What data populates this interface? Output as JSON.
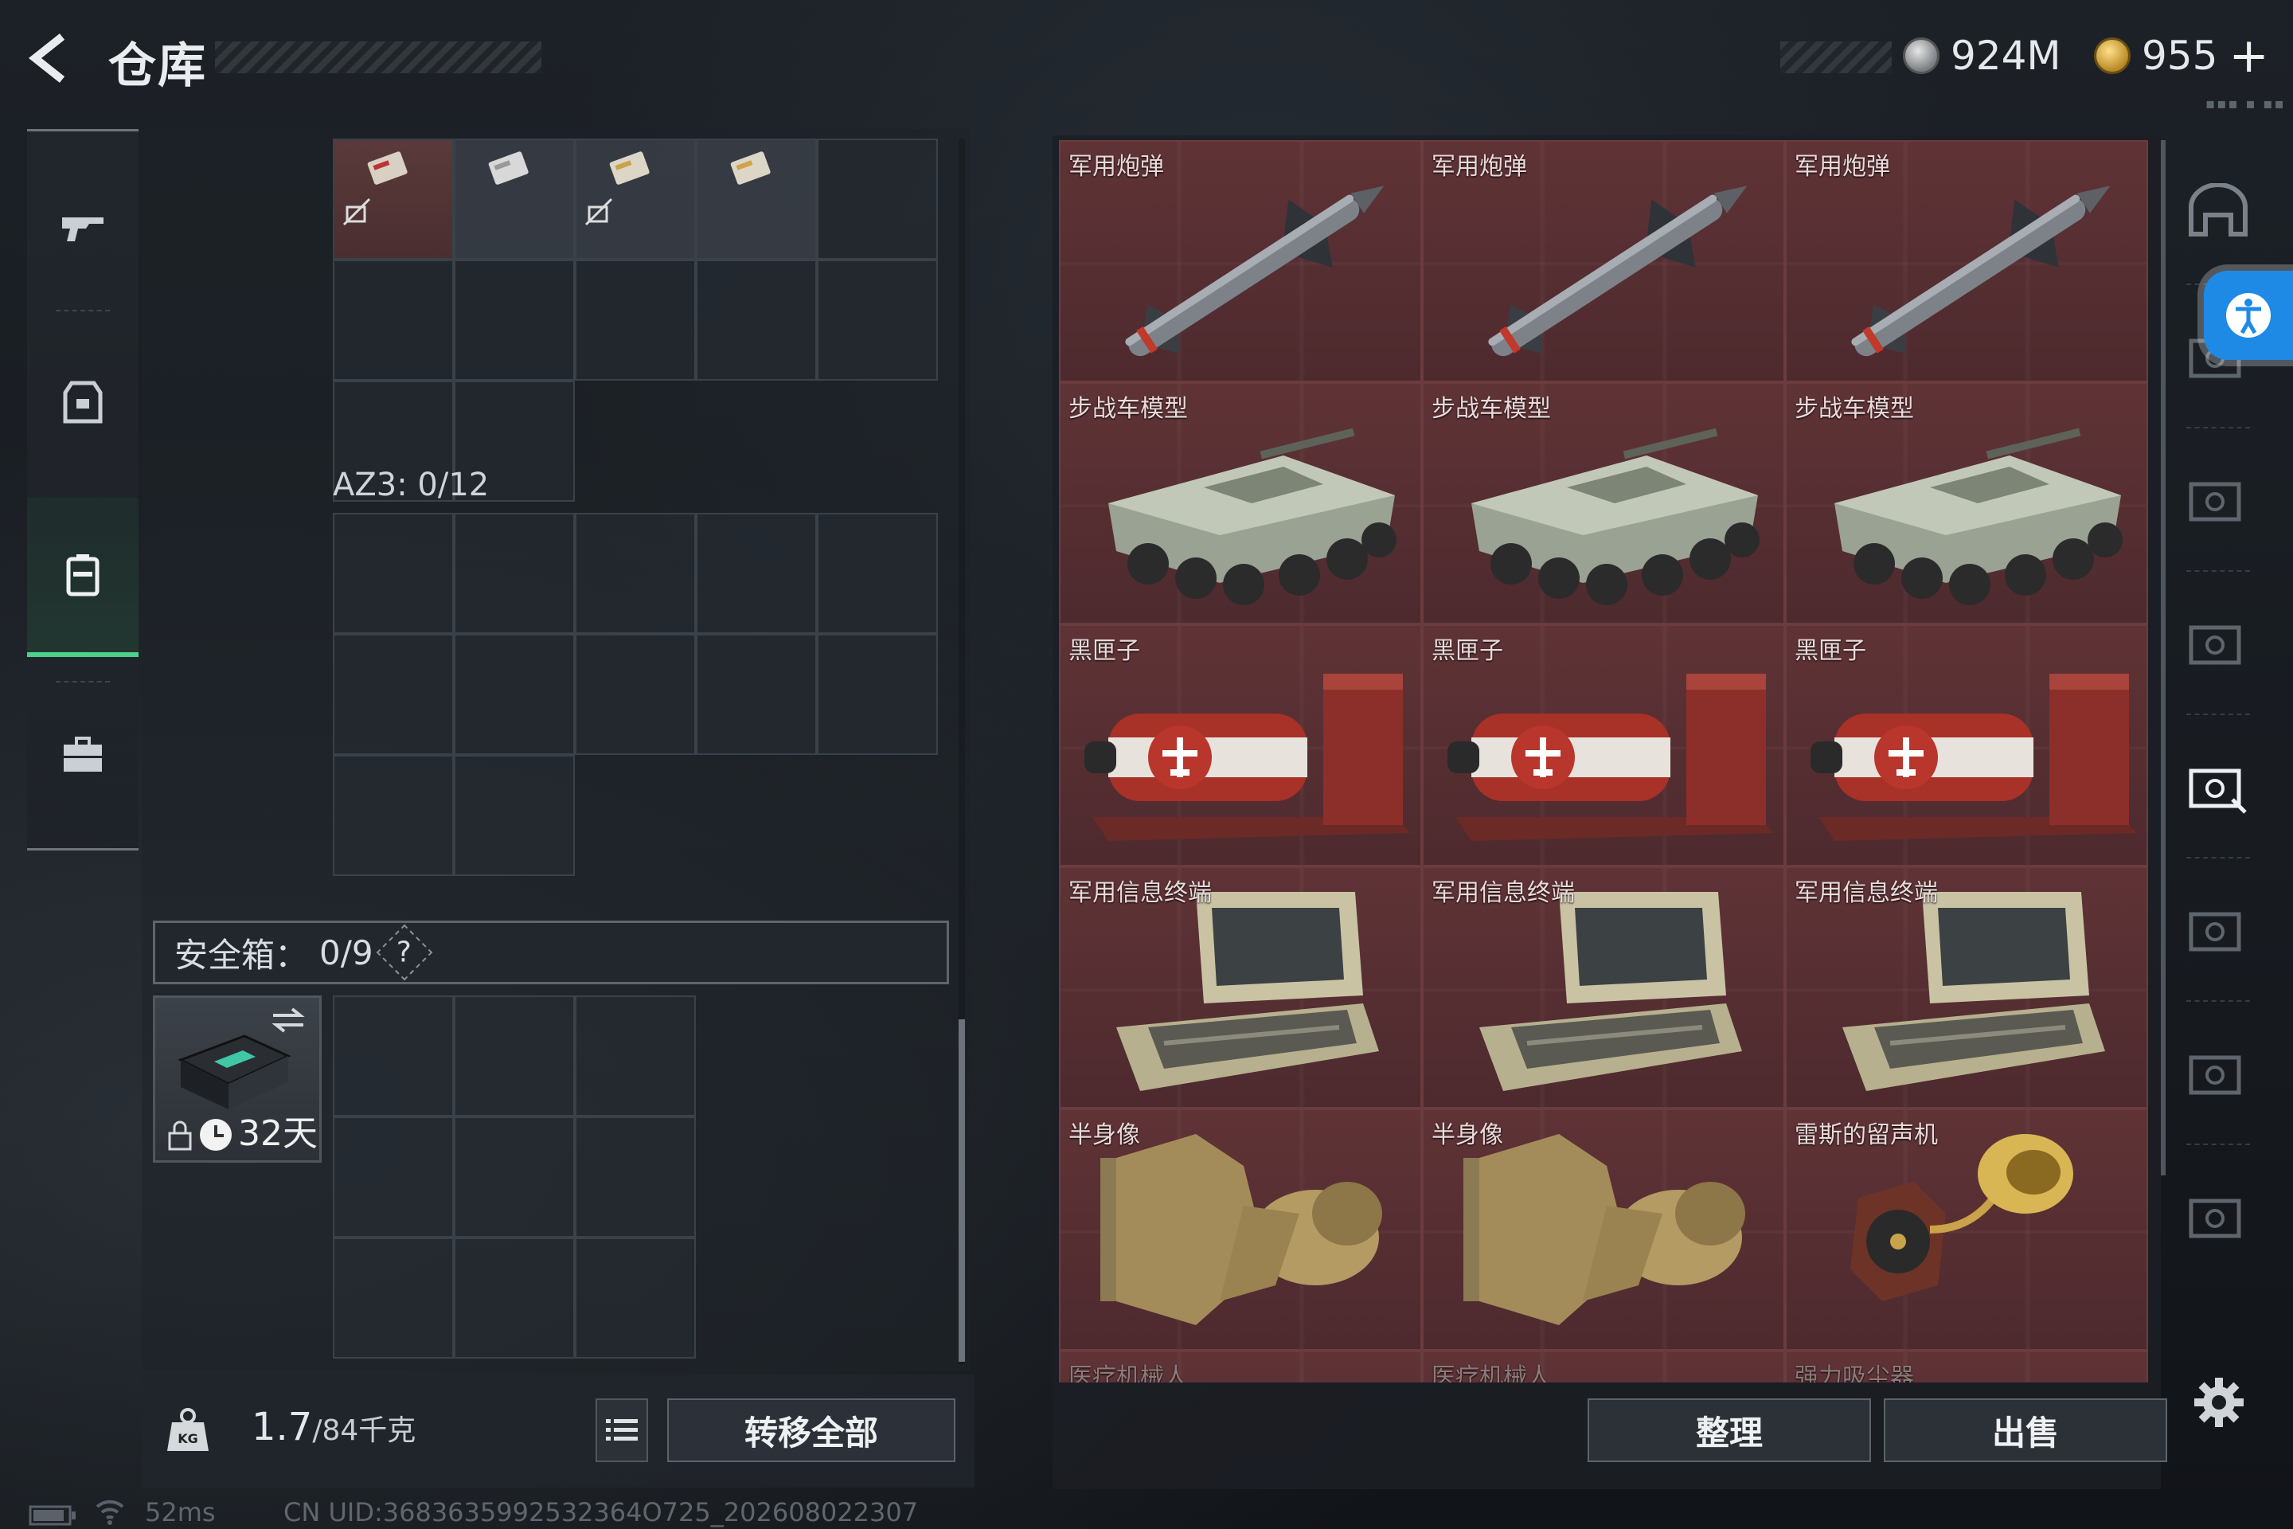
{
  "header": {
    "title": "仓库"
  },
  "currencies": [
    {
      "value": "924M",
      "icon": "silver-coin-icon"
    },
    {
      "value": "955",
      "icon": "gold-coin-icon"
    }
  ],
  "left_panel": {
    "az3_label": "AZ3: 0/12",
    "safe_box_label": "安全箱：",
    "safe_box_count": "0/9",
    "safe_help": "?",
    "safe_case_days": "32天"
  },
  "bottom_left": {
    "weight_current": "1.7",
    "weight_max": "/84千克",
    "transfer_all": "转移全部"
  },
  "items": [
    {
      "name": "军用炮弹",
      "icon": "missile"
    },
    {
      "name": "军用炮弹",
      "icon": "missile"
    },
    {
      "name": "军用炮弹",
      "icon": "missile"
    },
    {
      "name": "步战车模型",
      "icon": "ifv-model"
    },
    {
      "name": "步战车模型",
      "icon": "ifv-model"
    },
    {
      "name": "步战车模型",
      "icon": "ifv-model"
    },
    {
      "name": "黑匣子",
      "icon": "black-box"
    },
    {
      "name": "黑匣子",
      "icon": "black-box"
    },
    {
      "name": "黑匣子",
      "icon": "black-box"
    },
    {
      "name": "军用信息终端",
      "icon": "military-terminal"
    },
    {
      "name": "军用信息终端",
      "icon": "military-terminal"
    },
    {
      "name": "军用信息终端",
      "icon": "military-terminal"
    },
    {
      "name": "半身像",
      "icon": "bust"
    },
    {
      "name": "半身像",
      "icon": "bust"
    },
    {
      "name": "雷斯的留声机",
      "icon": "gramophone"
    },
    {
      "name": "医疗机械人",
      "icon": "medical-robot"
    },
    {
      "name": "医疗机械人",
      "icon": "medical-robot"
    },
    {
      "name": "强力吸尘器",
      "icon": "vacuum"
    }
  ],
  "bottom_right": {
    "organize": "整理",
    "sell": "出售"
  },
  "status": {
    "ping": "52ms",
    "uid": "CN UID:3683635992532364O725_202608022307"
  },
  "colors": {
    "accent_green": "#4dd08a",
    "item_red": "#5f3336",
    "accessibility_blue": "#1e8ae6"
  }
}
